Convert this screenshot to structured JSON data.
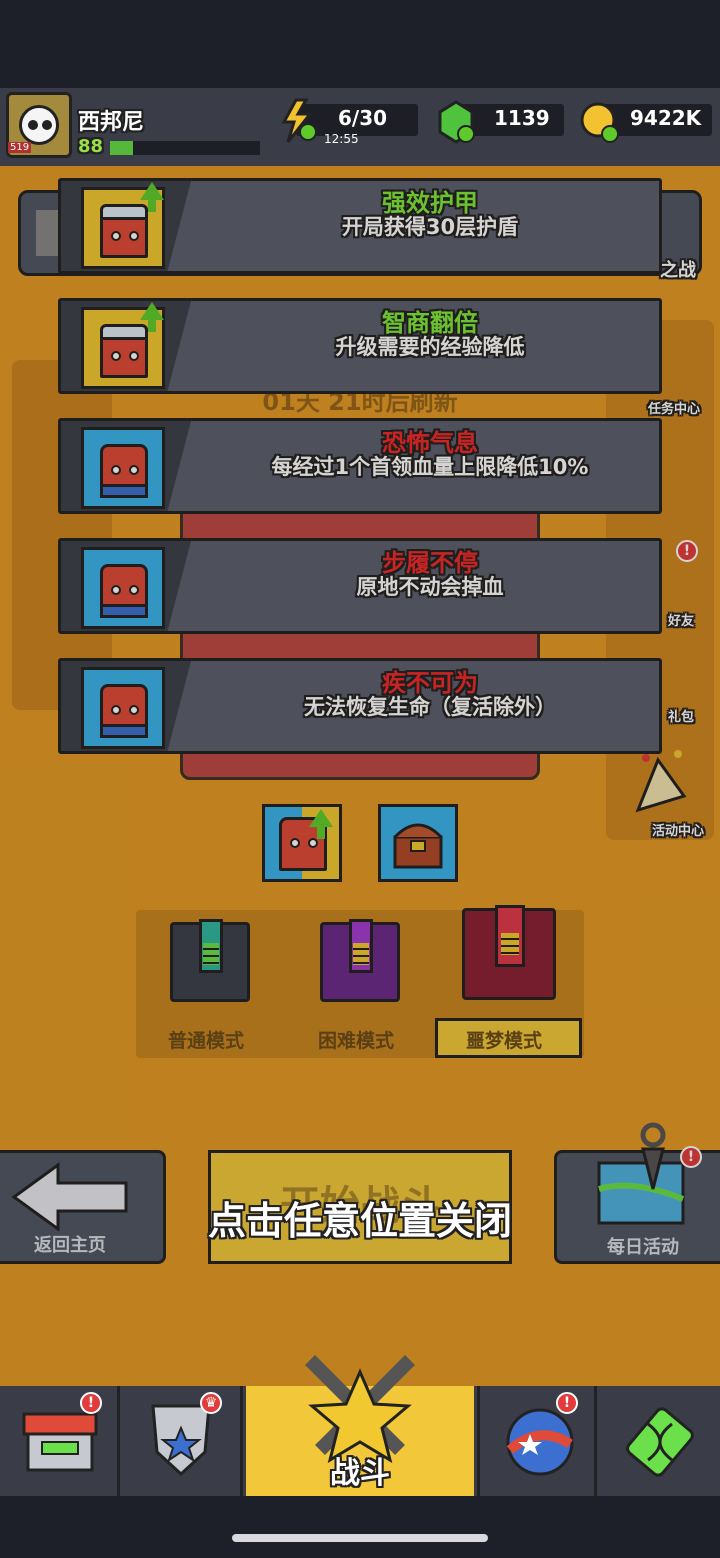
{
  "player": {
    "name": "西邦尼",
    "level": "88",
    "avatar_badge": "519",
    "xp_progress": 0.15
  },
  "resources": {
    "energy": "6/30",
    "energy_timer": "12:55",
    "gems": "1139",
    "coins": "9422K"
  },
  "buffs": [
    {
      "title": "强效护甲",
      "desc": "开局获得30层护盾",
      "title_color": "#7fe83a",
      "icon": "armored-hero-upgrade-icon"
    },
    {
      "title": "智商翻倍",
      "desc": "升级需要的经验降低",
      "title_color": "#7fe83a",
      "icon": "armored-hero-upgrade-icon"
    },
    {
      "title": "恐怖气息",
      "desc": "每经过1个首领血量上限降低10%",
      "title_color": "#ee2a2a",
      "icon": "red-blob-enemy-icon"
    },
    {
      "title": "步履不停",
      "desc": "原地不动会掉血",
      "title_color": "#ee2a2a",
      "icon": "red-blob-enemy-icon"
    },
    {
      "title": "疾不可为",
      "desc": "无法恢复生命（复活除外）",
      "title_color": "#ee2a2a",
      "icon": "red-blob-enemy-icon"
    }
  ],
  "background_text": {
    "refresh": "01天 21时后刷新",
    "battle_of": "之战",
    "task_center": "任务中心",
    "friends": "好友",
    "gift_pack": "礼包",
    "activity_center": "活动中心"
  },
  "modes": [
    {
      "label": "普通模式",
      "color": "#2fb6a0"
    },
    {
      "label": "困难模式",
      "color": "#a53bd0"
    },
    {
      "label": "噩梦模式",
      "color": "#e0394b"
    }
  ],
  "selected_mode": "噩梦模式",
  "buttons": {
    "back": "返回主页",
    "start": "开始战斗",
    "daily": "每日活动"
  },
  "close_hint": "点击任意位置关闭",
  "nav": {
    "shop": "shop-icon",
    "talent": "shield-icon",
    "battle": "战斗",
    "pets": "orb-icon",
    "evolve": "dna-icon"
  },
  "colors": {
    "accent_yellow": "#f2c83a",
    "bg_orange": "#e49a25",
    "panel_gray": "#5b5f6d",
    "badge_red": "#e23b3b"
  }
}
